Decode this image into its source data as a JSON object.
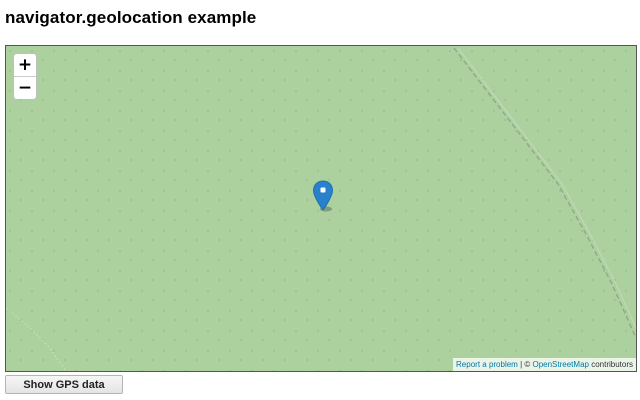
{
  "page": {
    "title": "navigator.geolocation example"
  },
  "map": {
    "zoom_in_label": "+",
    "zoom_out_label": "−",
    "marker_icon": "map-marker-icon",
    "marker_color": "#2a81cb",
    "terrain_color": "#add19e",
    "attribution": {
      "report_link": "Report a problem",
      "separator": " | © ",
      "osm_link": "OpenStreetMap",
      "suffix": " contributors"
    }
  },
  "controls": {
    "show_gps_label": "Show GPS data"
  }
}
